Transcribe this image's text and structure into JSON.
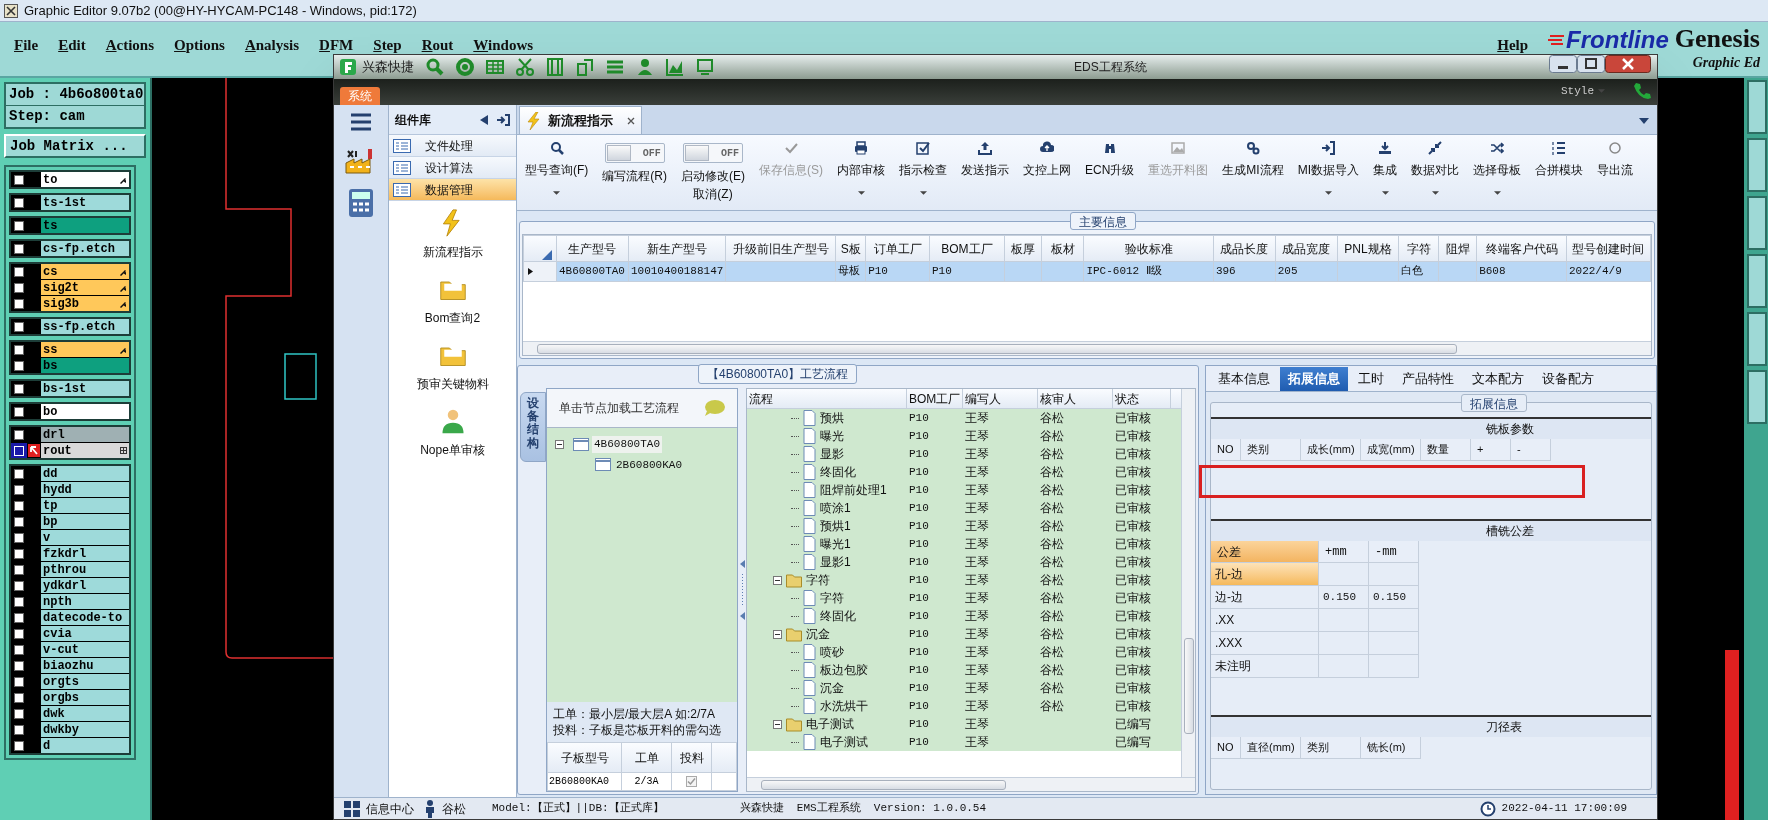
{
  "genesis": {
    "title": "Graphic Editor 9.07b2 (00@HY-HYCAM-PC148 - Windows, pid:172)",
    "menu": [
      "File",
      "Edit",
      "Actions",
      "Options",
      "Analysis",
      "DFM",
      "Step",
      "Rout",
      "Windows",
      "Help"
    ],
    "brand": "Frontline",
    "product": "Genesis",
    "subtitle": "Graphic Ed",
    "job": "Job : 4b6o800ta0",
    "step": "Step: cam",
    "job_matrix": "Job Matrix ...",
    "layer_groups": [
      [
        {
          "name": "to",
          "color": "#ffffff",
          "hand": true,
          "active": false
        }
      ],
      [
        {
          "name": "ts-1st",
          "color": "#9edada",
          "hand": false,
          "active": false
        }
      ],
      [
        {
          "name": "ts",
          "color": "#0ea07f",
          "hand": false,
          "active": false
        }
      ],
      [
        {
          "name": "cs-fp.etch",
          "color": "#9edada",
          "hand": false,
          "active": false
        }
      ],
      [
        {
          "name": "cs",
          "color": "#ffc85a",
          "hand": true,
          "active": false
        },
        {
          "name": "sig2t",
          "color": "#ffc85a",
          "hand": true,
          "active": false
        },
        {
          "name": "sig3b",
          "color": "#ffc85a",
          "hand": true,
          "active": false
        }
      ],
      [
        {
          "name": "ss-fp.etch",
          "color": "#9edada",
          "hand": false,
          "active": false
        }
      ],
      [
        {
          "name": "ss",
          "color": "#ffc85a",
          "hand": true,
          "active": false
        },
        {
          "name": "bs",
          "color": "#0ea07f",
          "hand": false,
          "active": false
        }
      ],
      [
        {
          "name": "bs-1st",
          "color": "#9edada",
          "hand": false,
          "active": false
        }
      ],
      [
        {
          "name": "bo",
          "color": "#ffffff",
          "hand": false,
          "active": false
        }
      ],
      [
        {
          "name": "drl",
          "color": "#9fb0b3",
          "hand": false,
          "active": false
        },
        {
          "name": "rout",
          "color": "#d9d9d9",
          "hand": false,
          "active": true
        }
      ],
      [
        {
          "name": "dd",
          "color": "#9edada",
          "hand": false,
          "active": false
        },
        {
          "name": "hydd",
          "color": "#9edada",
          "hand": false,
          "active": false
        },
        {
          "name": "tp",
          "color": "#9edada",
          "hand": false,
          "active": false
        },
        {
          "name": "bp",
          "color": "#9edada",
          "hand": false,
          "active": false
        },
        {
          "name": "v",
          "color": "#9edada",
          "hand": false,
          "active": false
        },
        {
          "name": "fzkdrl",
          "color": "#9edada",
          "hand": false,
          "active": false
        },
        {
          "name": "pthrou",
          "color": "#9edada",
          "hand": false,
          "active": false
        },
        {
          "name": "ydkdrl",
          "color": "#9edada",
          "hand": false,
          "active": false
        },
        {
          "name": "npth",
          "color": "#9edada",
          "hand": false,
          "active": false
        },
        {
          "name": "datecode-to",
          "color": "#9edada",
          "hand": false,
          "active": false
        },
        {
          "name": "cvia",
          "color": "#9edada",
          "hand": false,
          "active": false
        },
        {
          "name": "v-cut",
          "color": "#9edada",
          "hand": false,
          "active": false
        },
        {
          "name": "biaozhu",
          "color": "#9edada",
          "hand": false,
          "active": false
        },
        {
          "name": "orgts",
          "color": "#9edada",
          "hand": false,
          "active": false
        },
        {
          "name": "orgbs",
          "color": "#9edada",
          "hand": false,
          "active": false
        },
        {
          "name": "dwk",
          "color": "#9edada",
          "hand": false,
          "active": false
        },
        {
          "name": "dwkby",
          "color": "#9edada",
          "hand": false,
          "active": false
        },
        {
          "name": "d",
          "color": "#9edada",
          "hand": false,
          "active": false
        }
      ]
    ]
  },
  "eds": {
    "app_name": "兴森快捷",
    "title": "EDS工程系统",
    "system_tab": "系统",
    "style": "Style",
    "sidebar_title": "组件库",
    "groups": [
      {
        "label": "文件处理",
        "selected": false
      },
      {
        "label": "设计算法",
        "selected": false
      },
      {
        "label": "数据管理",
        "selected": true
      }
    ],
    "modules": [
      "新流程指示",
      "Bom查询2",
      "预审关键物料",
      "Nope单审核"
    ],
    "doc_tab": "新流程指示",
    "ribbon": [
      {
        "kind": "button",
        "label": "型号查询(F)",
        "disabled": false,
        "dropdown": true
      },
      {
        "kind": "toggle",
        "label": "编写流程(R)",
        "on": false,
        "state": "OFF"
      },
      {
        "kind": "toggle",
        "label": "启动修改(E)",
        "label_2": "取消(Z)",
        "on": false,
        "state": "OFF"
      },
      {
        "kind": "button",
        "label": "保存信息(S)",
        "disabled": true,
        "dropdown": false
      },
      {
        "kind": "button",
        "label": "内部审核",
        "disabled": false,
        "dropdown": true
      },
      {
        "kind": "button",
        "label": "指示检查",
        "disabled": false,
        "dropdown": true
      },
      {
        "kind": "button",
        "label": "发送指示",
        "disabled": false,
        "dropdown": false
      },
      {
        "kind": "button",
        "label": "文控上网",
        "disabled": false,
        "dropdown": false
      },
      {
        "kind": "button",
        "label": "ECN升级",
        "disabled": false,
        "dropdown": false
      },
      {
        "kind": "button",
        "label": "重选开料图",
        "disabled": true,
        "dropdown": false
      },
      {
        "kind": "button",
        "label": "生成MI流程",
        "disabled": false,
        "dropdown": false
      },
      {
        "kind": "button",
        "label": "MI数据导入",
        "disabled": false,
        "dropdown": true
      },
      {
        "kind": "button",
        "label": "集成",
        "disabled": false,
        "dropdown": true
      },
      {
        "kind": "button",
        "label": "数据对比",
        "disabled": false,
        "dropdown": true
      },
      {
        "kind": "button",
        "label": "选择母板",
        "disabled": false,
        "dropdown": true
      },
      {
        "kind": "button",
        "label": "合拼模块",
        "disabled": false,
        "dropdown": false
      },
      {
        "kind": "button",
        "label": "导出流",
        "disabled": false,
        "dropdown": false
      }
    ],
    "main_info": {
      "title": "主要信息",
      "columns": [
        "生产型号",
        "新生产型号",
        "升级前旧生产型号",
        "S板",
        "订单工厂",
        "BOM工厂",
        "板厚",
        "板材",
        "验收标准",
        "成品长度",
        "成品宽度",
        "PNL规格",
        "字符",
        "阻焊",
        "终端客户代码",
        "型号创建时间"
      ],
      "rows": [
        {
          "selected": true,
          "cells": {
            "0": "4B60800TA0",
            "1": "10010400188147",
            "3": "母板",
            "4": "P10",
            "5": "P10",
            "8": "IPC-6012 Ⅱ级",
            "9": "396",
            "10": "205",
            "12": "白色",
            "14": "B608",
            "15": "2022/4/9"
          }
        }
      ]
    },
    "process": {
      "title": "【4B60800TA0】工艺流程",
      "side_tab": "设备结构",
      "hint": "单击节点加载工艺流程",
      "tree": [
        {
          "label": "4B60800TA0",
          "expanded": true,
          "children": [
            {
              "label": "2B60800KA0"
            }
          ]
        }
      ],
      "notes": [
        "工单：最小层/最大层A 如:2/7A",
        "投料：子板是芯板开料的需勾选"
      ],
      "sub_columns": [
        "子板型号",
        "工单",
        "投料"
      ],
      "sub_rows": [
        {
          "model": "2B60800KA0",
          "order": "2/3A",
          "checked": true
        }
      ],
      "flow_columns": [
        "流程",
        "BOM工厂",
        "编写人",
        "核审人",
        "状态"
      ],
      "flow": [
        {
          "kind": "step",
          "name": "预烘",
          "bom": "P10",
          "writer": "王琴",
          "reviewer": "谷松",
          "status": "已审核"
        },
        {
          "kind": "step",
          "name": "曝光",
          "bom": "P10",
          "writer": "王琴",
          "reviewer": "谷松",
          "status": "已审核"
        },
        {
          "kind": "step",
          "name": "显影",
          "bom": "P10",
          "writer": "王琴",
          "reviewer": "谷松",
          "status": "已审核"
        },
        {
          "kind": "step",
          "name": "终固化",
          "bom": "P10",
          "writer": "王琴",
          "reviewer": "谷松",
          "status": "已审核"
        },
        {
          "kind": "step",
          "name": "阻焊前处理1",
          "bom": "P10",
          "writer": "王琴",
          "reviewer": "谷松",
          "status": "已审核"
        },
        {
          "kind": "step",
          "name": "喷涂1",
          "bom": "P10",
          "writer": "王琴",
          "reviewer": "谷松",
          "status": "已审核"
        },
        {
          "kind": "step",
          "name": "预烘1",
          "bom": "P10",
          "writer": "王琴",
          "reviewer": "谷松",
          "status": "已审核"
        },
        {
          "kind": "step",
          "name": "曝光1",
          "bom": "P10",
          "writer": "王琴",
          "reviewer": "谷松",
          "status": "已审核"
        },
        {
          "kind": "step",
          "name": "显影1",
          "bom": "P10",
          "writer": "王琴",
          "reviewer": "谷松",
          "status": "已审核"
        },
        {
          "kind": "folder",
          "name": "字符",
          "bom": "P10",
          "writer": "王琴",
          "reviewer": "谷松",
          "status": "已审核",
          "expanded": true,
          "children": [
            {
              "kind": "step",
              "name": "字符",
              "bom": "P10",
              "writer": "王琴",
              "reviewer": "谷松",
              "status": "已审核"
            },
            {
              "kind": "step",
              "name": "终固化",
              "bom": "P10",
              "writer": "王琴",
              "reviewer": "谷松",
              "status": "已审核"
            }
          ]
        },
        {
          "kind": "folder",
          "name": "沉金",
          "bom": "P10",
          "writer": "王琴",
          "reviewer": "谷松",
          "status": "已审核",
          "expanded": true,
          "children": [
            {
              "kind": "step",
              "name": "喷砂",
              "bom": "P10",
              "writer": "王琴",
              "reviewer": "谷松",
              "status": "已审核"
            },
            {
              "kind": "step",
              "name": "板边包胶",
              "bom": "P10",
              "writer": "王琴",
              "reviewer": "谷松",
              "status": "已审核"
            },
            {
              "kind": "step",
              "name": "沉金",
              "bom": "P10",
              "writer": "王琴",
              "reviewer": "谷松",
              "status": "已审核"
            },
            {
              "kind": "step",
              "name": "水洗烘干",
              "bom": "P10",
              "writer": "王琴",
              "reviewer": "谷松",
              "status": "已审核"
            }
          ]
        },
        {
          "kind": "folder",
          "name": "电子测试",
          "bom": "P10",
          "writer": "王琴",
          "status": "已编写",
          "expanded": true,
          "children": [
            {
              "kind": "step",
              "name": "电子测试",
              "bom": "P10",
              "writer": "王琴",
              "status": "已编写"
            }
          ]
        }
      ]
    },
    "details": {
      "tabs": [
        {
          "label": "基本信息",
          "selected": false
        },
        {
          "label": "拓展信息",
          "selected": true
        },
        {
          "label": "工时",
          "selected": false
        },
        {
          "label": "产品特性",
          "selected": false
        },
        {
          "label": "文本配方",
          "selected": false
        },
        {
          "label": "设备配方",
          "selected": false
        }
      ],
      "group_title": "拓展信息",
      "milling": {
        "title": "铣板参数",
        "columns": [
          "NO",
          "类别",
          "成长(mm)",
          "成宽(mm)",
          "数量",
          "+",
          "-"
        ]
      },
      "tolerance": {
        "title": "槽铣公差",
        "columns": [
          "公差",
          "+mm",
          "-mm"
        ],
        "rows": [
          {
            "label": "孔-边",
            "selected": true
          },
          {
            "label": "边-边",
            "selected": false,
            "plus": "0.150",
            "minus": "0.150"
          },
          {
            "label": ".XX",
            "selected": false
          },
          {
            "label": ".XXX",
            "selected": false
          },
          {
            "label": "未注明",
            "selected": false
          }
        ]
      },
      "tools": {
        "title": "刀径表",
        "columns": [
          "NO",
          "直径(mm)",
          "类别",
          "铣长(m)"
        ]
      }
    },
    "status_bar": {
      "info": "信息中心",
      "user": "谷松",
      "model": "Model:【正式】||DB:【正式库】",
      "version": "兴森快捷  EMS工程系统  Version: 1.0.0.54",
      "time": "2022-04-11 17:00:09"
    }
  }
}
